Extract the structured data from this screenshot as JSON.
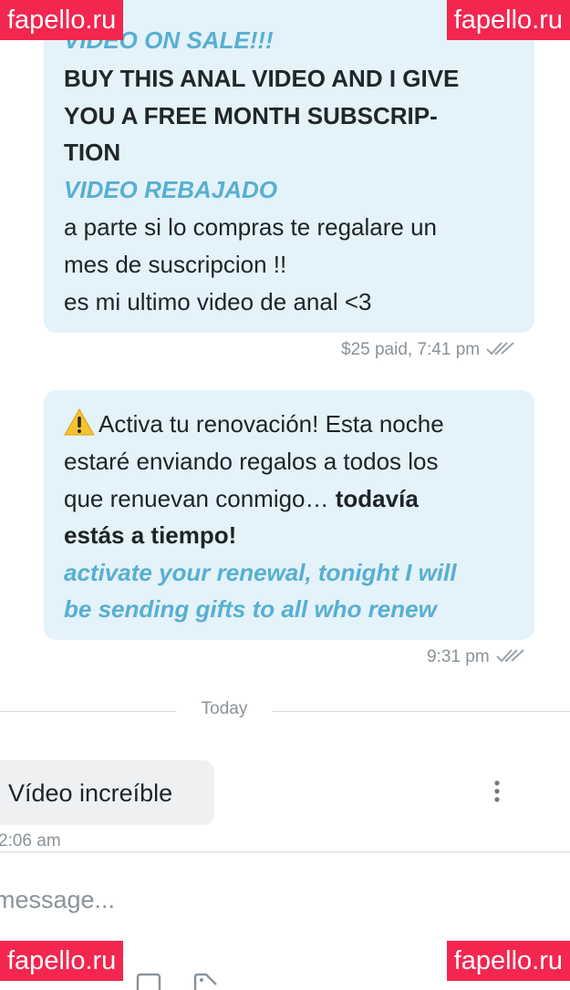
{
  "messages": [
    {
      "lines": [
        "VIDEO ON SALE!!!",
        "BUY THIS ANAL VIDEO AND I GIVE",
        "YOU A FREE MONTH SUBSCRIP-",
        "TION",
        "VIDEO REBAJADO",
        "a parte si lo compras te regalare un",
        "mes de suscripcion !!",
        "es mi ultimo video de anal <3"
      ],
      "meta": "$25 paid, 7:41 pm"
    },
    {
      "line1": "Activa tu renovación! Esta noche",
      "line2": "estaré enviando regalos a todos los",
      "line3_regular": "que renuevan conmigo… ",
      "line3_bold": "todavía",
      "line4_bold": "estás a tiempo!",
      "line5": "activate your renewal, tonight I will",
      "line6": "be sending gifts to all who renew",
      "meta": "9:31 pm",
      "icon": "warning-icon"
    }
  ],
  "day_separator": "Today",
  "incoming": {
    "text": "Vídeo increíble",
    "time": "2:06 am"
  },
  "composer": {
    "placeholder": "message..."
  },
  "watermarks": {
    "top_left": "fapello.ru",
    "top_right": "fapello.ru",
    "bottom_left": "fapello.ru",
    "bottom_right": "fapello.ru"
  },
  "colors": {
    "bubble": "#e4f2f9",
    "translation_text": "#58afd2",
    "watermark": "#f2264f",
    "meta_text": "#8a9399"
  }
}
